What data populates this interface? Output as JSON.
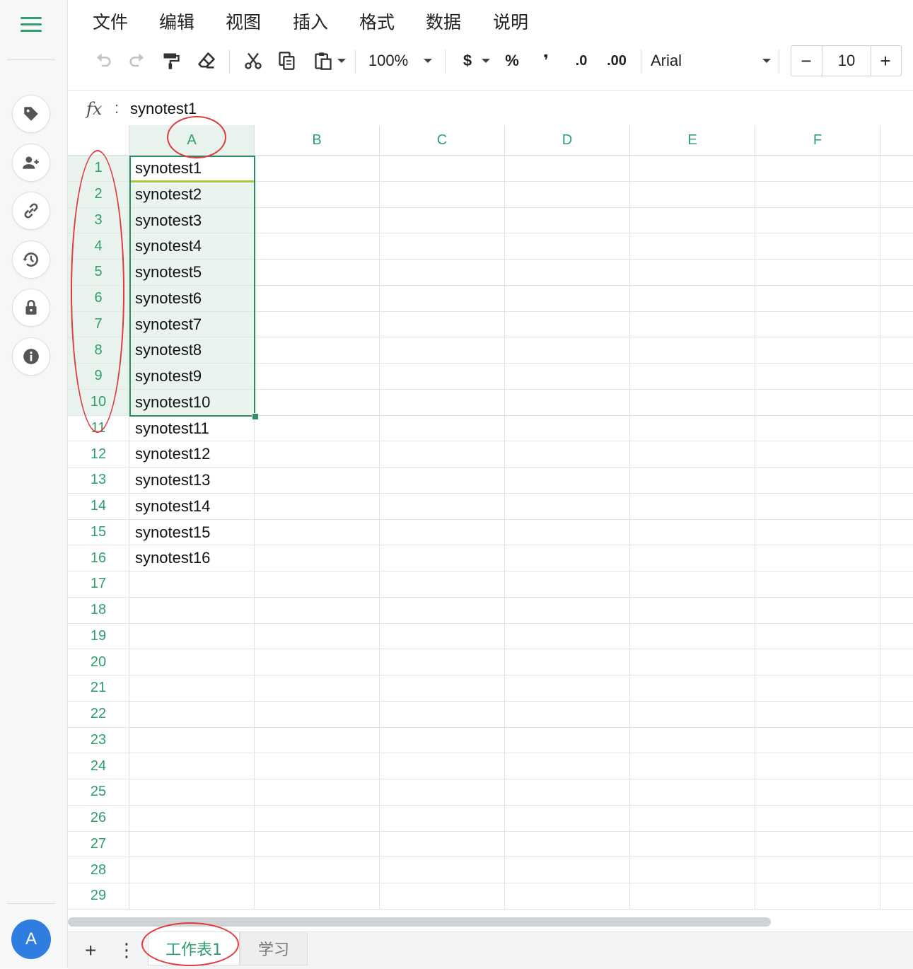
{
  "menu": [
    "文件",
    "编辑",
    "视图",
    "插入",
    "格式",
    "数据",
    "说明"
  ],
  "toolbar": {
    "zoom": "100%",
    "currency": "$",
    "percent": "%",
    "comma": "❜",
    "decrease_decimal": ".0",
    "increase_decimal": ".00",
    "font": "Arial",
    "font_size": "10",
    "minus": "−",
    "plus": "+"
  },
  "formula_bar": {
    "fx": "fx",
    "colon": ":",
    "value": "synotest1"
  },
  "columns": [
    "A",
    "B",
    "C",
    "D",
    "E",
    "F"
  ],
  "rows": [
    "1",
    "2",
    "3",
    "4",
    "5",
    "6",
    "7",
    "8",
    "9",
    "10",
    "11",
    "12",
    "13",
    "14",
    "15",
    "16",
    "17",
    "18",
    "19",
    "20",
    "21",
    "22",
    "23",
    "24",
    "25",
    "26",
    "27",
    "28",
    "29"
  ],
  "cells_A": [
    "synotest1",
    "synotest2",
    "synotest3",
    "synotest4",
    "synotest5",
    "synotest6",
    "synotest7",
    "synotest8",
    "synotest9",
    "synotest10",
    "synotest11",
    "synotest12",
    "synotest13",
    "synotest14",
    "synotest15",
    "synotest16"
  ],
  "selection": {
    "column": "A",
    "from_row": 1,
    "to_row": 10,
    "active_cell": "A1"
  },
  "sheet_tabs": {
    "add": "+",
    "more": "⋮",
    "active": "工作表1",
    "other": "学习"
  },
  "avatar_letter": "A",
  "icons": {
    "rail": [
      "tag-icon",
      "add-user-icon",
      "link-icon",
      "history-icon",
      "lock-icon",
      "info-icon"
    ],
    "toolbar": [
      "undo-icon",
      "redo-icon",
      "paint-format-icon",
      "clear-format-icon",
      "cut-icon",
      "copy-icon",
      "paste-icon"
    ]
  },
  "colors": {
    "accent": "#2e9e6e",
    "annotation": "#e0393e",
    "avatar": "#2f7de1"
  }
}
